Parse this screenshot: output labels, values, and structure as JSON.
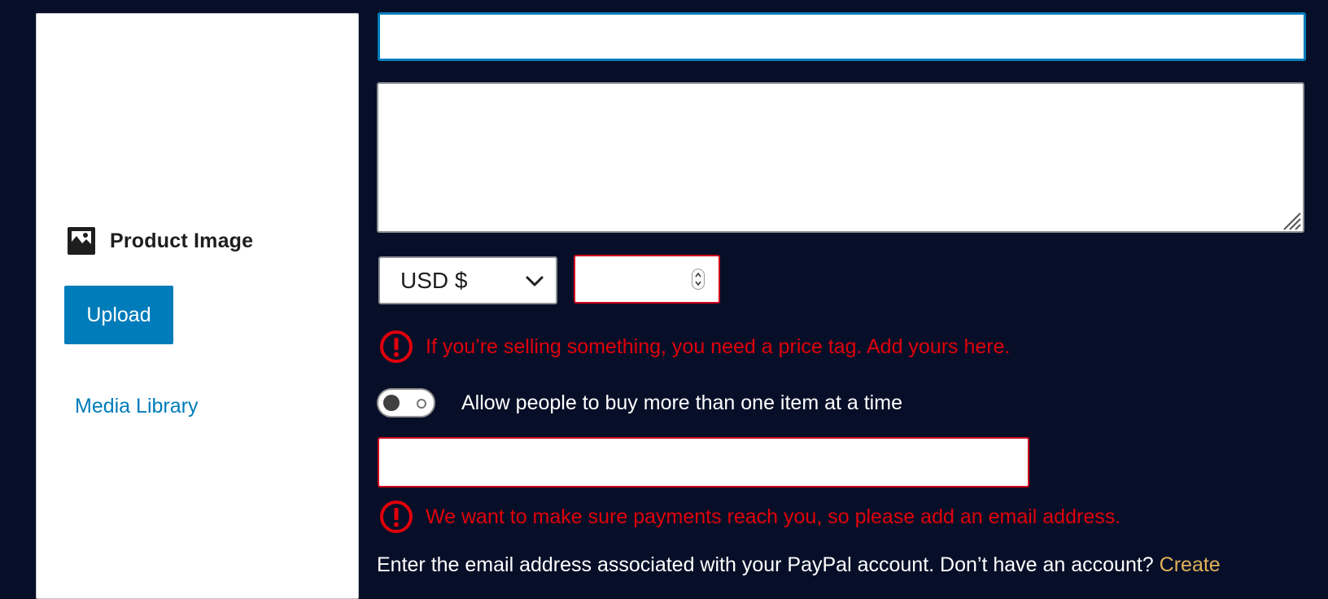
{
  "image_panel": {
    "label": "Product Image",
    "upload_button": "Upload",
    "media_library_link": "Media Library",
    "icon": "image-icon"
  },
  "title_field": {
    "value": "",
    "placeholder": ""
  },
  "description_field": {
    "value": "",
    "placeholder": ""
  },
  "currency_select": {
    "selected": "USD $",
    "icon": "chevron-down-icon"
  },
  "price_field": {
    "value": "",
    "placeholder": ""
  },
  "price_error": {
    "message": "If you’re selling something, you need a price tag. Add yours here.",
    "icon": "error-icon"
  },
  "multiple_items_toggle": {
    "label": "Allow people to buy more than one item at a time",
    "checked": false
  },
  "email_field": {
    "value": "",
    "placeholder": ""
  },
  "email_error": {
    "message": "We want to make sure payments reach you, so please add an email address.",
    "icon": "error-icon"
  },
  "paypal_help": {
    "text": "Enter the email address associated with your PayPal account. Don’t have an account? ",
    "link": "Create"
  },
  "colors": {
    "background": "#070f28",
    "accent": "#007cba",
    "error": "#e0000b",
    "link_highlight": "#e2b15a"
  }
}
